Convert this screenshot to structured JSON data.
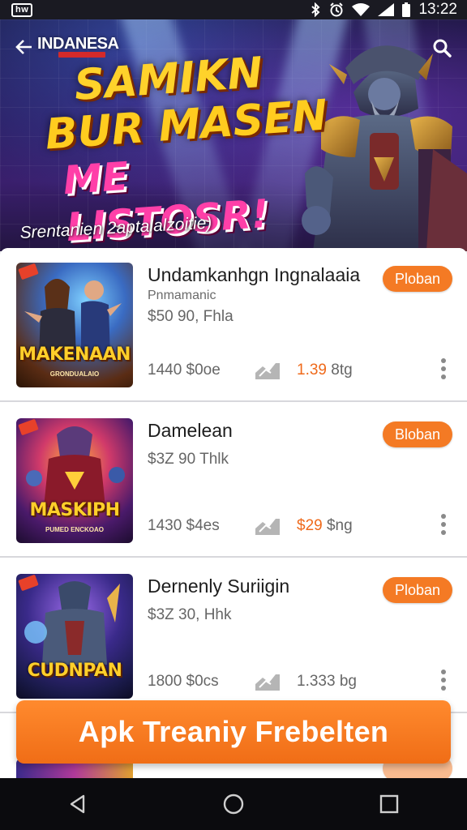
{
  "status_bar": {
    "carrier_badge": "hw",
    "time": "13:22",
    "icons": [
      "bluetooth-icon",
      "alarm-icon",
      "wifi-icon",
      "signal-icon",
      "battery-icon"
    ]
  },
  "header": {
    "brand": "INDANESA",
    "back_icon": "back-arrow-icon",
    "search_icon": "search-icon"
  },
  "hero": {
    "title_lines": [
      "SAMIKN",
      "BUR MASEN",
      "ME LISTOSR!"
    ],
    "subtitle": "Srentanien 2aptalalzoitie)"
  },
  "items": [
    {
      "title": "Undamkanhgn Ingnalaaia",
      "subtitle": "Pnmamanic",
      "price": "$50 90, Fhla",
      "size": "1440 $0oe",
      "rating_value": "1.39",
      "rating_unit": "8tg",
      "button": "Ploban",
      "thumb_title": "MAKENAAN",
      "thumb_sub": "GRONDUALAIO"
    },
    {
      "title": "Damelean",
      "subtitle": "",
      "price": "$3Z 90 Thlk",
      "size": "1430 $4es",
      "rating_value": "$29",
      "rating_unit": "$ng",
      "button": "Bloban",
      "thumb_title": "MASKIPH",
      "thumb_sub": "PUMED ENCKOAO"
    },
    {
      "title": "Dernenly Suriigin",
      "subtitle": "",
      "price": "$3Z 30, Hhk",
      "size": "1800 $0cs",
      "rating_value": "1.333",
      "rating_unit": "bg",
      "button": "Ploban",
      "thumb_title": "CUDNPAN",
      "thumb_sub": ""
    }
  ],
  "cta": {
    "label": "Apk Treaniy Frebelten"
  },
  "nav": {
    "back": "nav-back-icon",
    "home": "nav-home-icon",
    "recents": "nav-recents-icon"
  },
  "colors": {
    "accent": "#f47a24",
    "rating_accent": "#ef6a1b",
    "status_bar": "#1a1a22",
    "nav_bar": "#0b0b0e"
  }
}
